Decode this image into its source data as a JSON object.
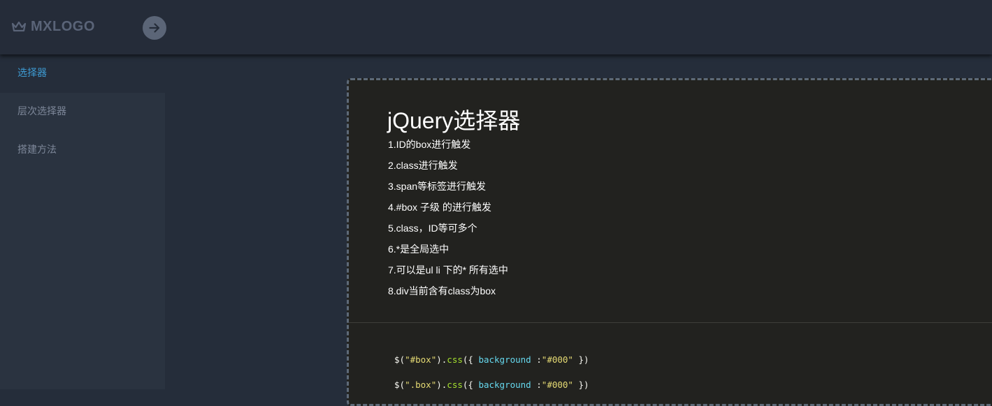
{
  "header": {
    "logo_text": "MXLOGO",
    "logo_icon": "crown-icon",
    "toggle_icon": "arrow-right-icon"
  },
  "sidebar": {
    "items": [
      {
        "label": "选择器",
        "active": true
      },
      {
        "label": "层次选择器",
        "active": false
      },
      {
        "label": "搭建方法",
        "active": false
      }
    ]
  },
  "content": {
    "title": "jQuery选择器",
    "items": [
      "1.ID的box进行触发",
      "2.class进行触发",
      "3.span等标签进行触发",
      "4.#box 子级 的进行触发",
      "5.class，ID等可多个",
      "6.*是全局选中",
      "7.可以是ul li 下的* 所有选中",
      "8.div当前含有class为box"
    ],
    "code_lines": [
      {
        "selector": "#box",
        "method": "css",
        "property": "background",
        "value": "#000"
      },
      {
        "selector": ".box",
        "method": "css",
        "property": "background",
        "value": "#000"
      }
    ]
  },
  "colors": {
    "header_bg": "#252c39",
    "sidebar_bg": "#2a3340",
    "active_item": "#3d9ad2",
    "card_bg": "#22221f"
  }
}
